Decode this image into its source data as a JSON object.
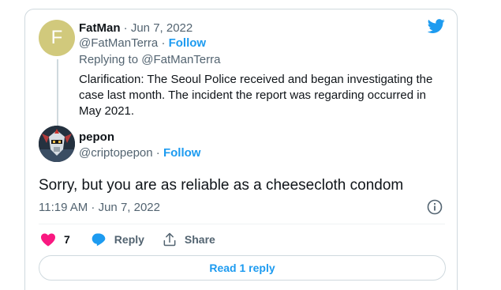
{
  "parent": {
    "avatar_letter": "F",
    "name": "FatMan",
    "separator": "·",
    "date": "Jun 7, 2022",
    "handle": "@FatManTerra",
    "follow_label": "Follow",
    "replying_prefix": "Replying to",
    "replying_to": "@FatManTerra",
    "text": "Clarification: The Seoul Police received and began investigating the case last month. The incident the report was regarding occurred in May 2021."
  },
  "main": {
    "name": "pepon",
    "handle": "@criptopepon",
    "separator": "·",
    "follow_label": "Follow",
    "text": "Sorry, but you are as reliable as a cheesecloth condom",
    "timestamp": "11:19 AM · Jun 7, 2022"
  },
  "actions": {
    "like_count": "7",
    "reply_label": "Reply",
    "share_label": "Share"
  },
  "read_replies_label": "Read 1 reply",
  "colors": {
    "accent": "#1d9bf0",
    "like": "#f91880",
    "muted": "#536471",
    "avatar_f": "#d1c97c"
  }
}
